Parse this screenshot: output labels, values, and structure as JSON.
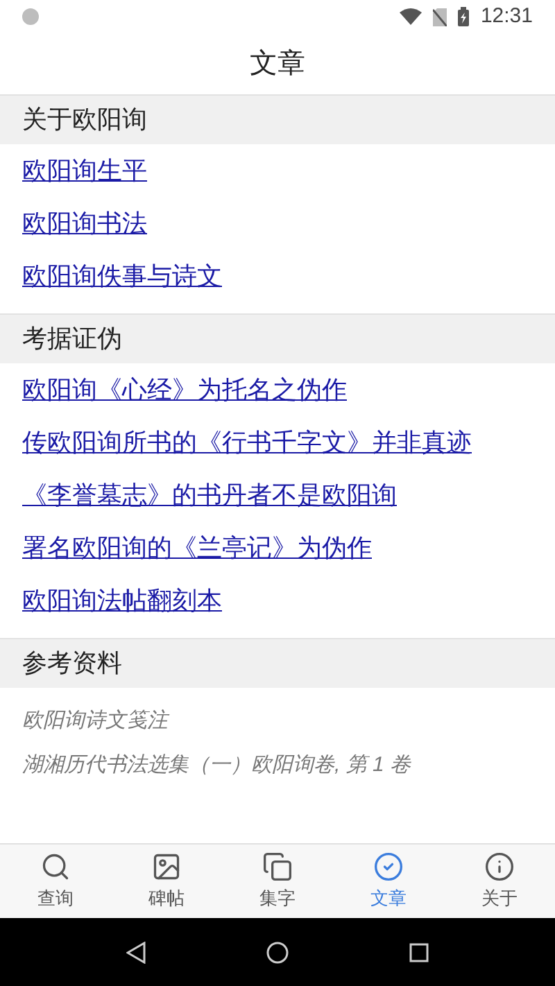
{
  "status_bar": {
    "time": "12:31"
  },
  "app_bar": {
    "title": "文章"
  },
  "sections": [
    {
      "title": "关于欧阳询",
      "kind": "links",
      "items": [
        "欧阳询生平",
        "欧阳询书法",
        "欧阳询佚事与诗文"
      ]
    },
    {
      "title": "考据证伪",
      "kind": "links",
      "items": [
        "欧阳询《心经》为托名之伪作",
        "传欧阳询所书的《行书千字文》并非真迹",
        "《李誉墓志》的书丹者不是欧阳询",
        "署名欧阳询的《兰亭记》为伪作",
        "欧阳询法帖翻刻本"
      ]
    },
    {
      "title": "参考资料",
      "kind": "references",
      "items": [
        "欧阳询诗文笺注",
        "湖湘历代书法选集（一）欧阳询卷, 第 1 卷"
      ]
    }
  ],
  "bottom_nav": [
    {
      "label": "查询",
      "selected": false
    },
    {
      "label": "碑帖",
      "selected": false
    },
    {
      "label": "集字",
      "selected": false
    },
    {
      "label": "文章",
      "selected": true
    },
    {
      "label": "关于",
      "selected": false
    }
  ]
}
